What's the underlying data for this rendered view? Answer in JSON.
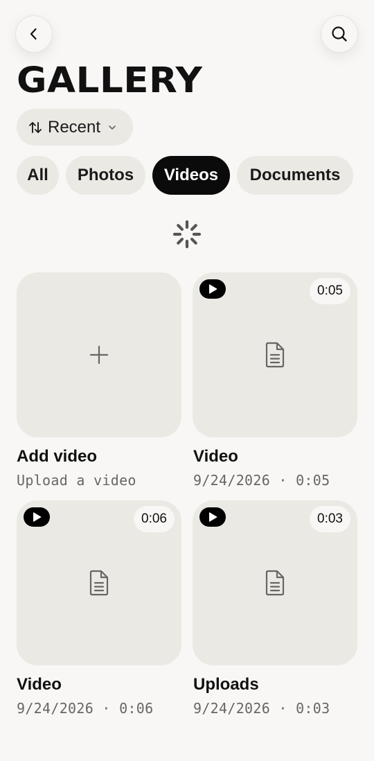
{
  "header": {
    "title": "GALLERY",
    "back_icon": "chevron-left-icon",
    "search_icon": "search-icon"
  },
  "sort": {
    "label": "Recent",
    "icon": "sort-arrows-icon",
    "chevron": "chevron-down-icon"
  },
  "tabs": [
    {
      "label": "All",
      "active": false
    },
    {
      "label": "Photos",
      "active": false
    },
    {
      "label": "Videos",
      "active": true
    },
    {
      "label": "Documents",
      "active": false
    }
  ],
  "loading": {
    "icon": "spinner-icon"
  },
  "items": [
    {
      "type": "add",
      "title": "Add video",
      "subtitle": "Upload a video",
      "icon": "plus-icon"
    },
    {
      "type": "video",
      "title": "Video",
      "date": "9/24/2026",
      "duration": "0:05",
      "subtitle": "9/24/2026 · 0:05",
      "icon": "document-icon"
    },
    {
      "type": "video",
      "title": "Video",
      "date": "9/24/2026",
      "duration": "0:06",
      "subtitle": "9/24/2026 · 0:06",
      "icon": "document-icon"
    },
    {
      "type": "video",
      "title": "Uploads",
      "date": "9/24/2026",
      "duration": "0:03",
      "subtitle": "9/24/2026 · 0:03",
      "icon": "document-icon"
    }
  ],
  "colors": {
    "background": "#f8f7f5",
    "card": "#ebe9e4",
    "active_tab": "#0b0b0b",
    "text": "#111111",
    "muted": "#666666"
  }
}
